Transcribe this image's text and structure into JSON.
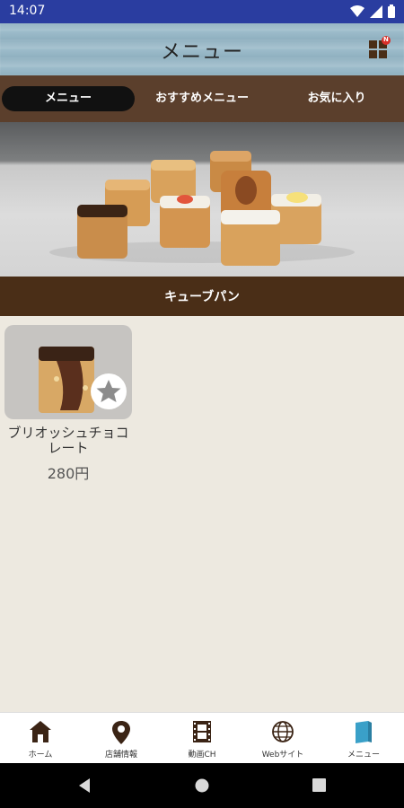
{
  "status_bar": {
    "time": "14:07"
  },
  "header": {
    "title": "メニュー",
    "badge": "N"
  },
  "tabs": [
    {
      "label": "メニュー",
      "active": true
    },
    {
      "label": "おすすめメニュー",
      "active": false
    },
    {
      "label": "お気に入り",
      "active": false
    }
  ],
  "category": {
    "name": "キューブパン"
  },
  "products": [
    {
      "name": "ブリオッシュチョコレート",
      "price": "280円",
      "favorite": false
    }
  ],
  "bottom_nav": [
    {
      "label": "ホーム",
      "icon": "home-icon"
    },
    {
      "label": "店舗情報",
      "icon": "location-pin-icon"
    },
    {
      "label": "動画CH",
      "icon": "film-icon"
    },
    {
      "label": "Webサイト",
      "icon": "globe-icon"
    },
    {
      "label": "メニュー",
      "icon": "book-icon"
    }
  ],
  "colors": {
    "status_bar": "#2a3da0",
    "tab_bar": "#5b3f2c",
    "category_bar": "#4a2e17",
    "background": "#ede9e0",
    "menu_icon_accent": "#3aa0c8"
  }
}
